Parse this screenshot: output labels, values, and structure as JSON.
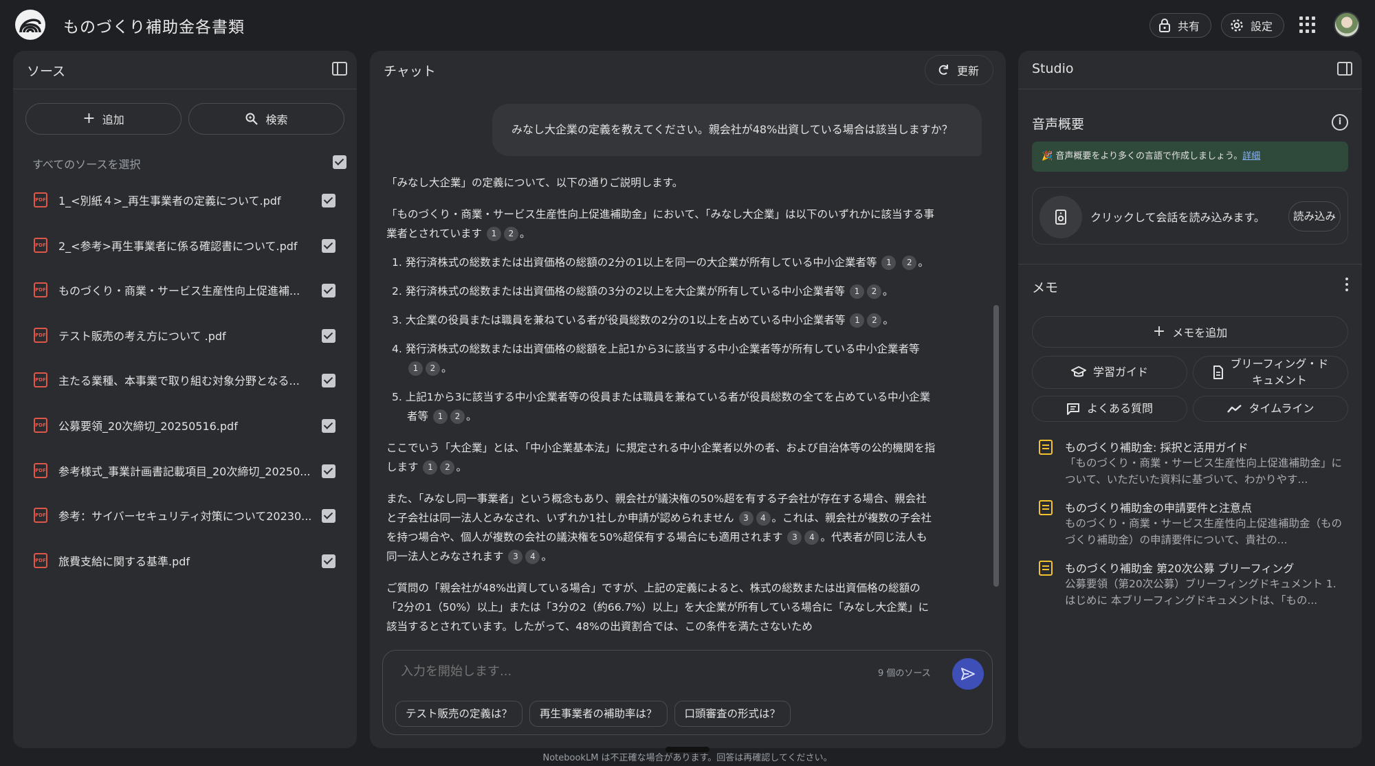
{
  "app": {
    "title": "ものづくり補助金各書類"
  },
  "header": {
    "share_label": "共有",
    "settings_label": "設定"
  },
  "sources": {
    "title": "ソース",
    "add_label": "追加",
    "search_label": "検索",
    "select_all_label": "すべてのソースを選択",
    "items": [
      {
        "label": "1_<別紙４>_再生事業者の定義について.pdf",
        "checked": true
      },
      {
        "label": "2_<参考>再生事業者に係る確認書について.pdf",
        "checked": true
      },
      {
        "label": "ものづくり・商業・サービス生産性向上促進補...",
        "checked": true
      },
      {
        "label": "テスト販売の考え方について .pdf",
        "checked": true
      },
      {
        "label": "主たる業種、本事業で取り組む対象分野となる...",
        "checked": true
      },
      {
        "label": "公募要領_20次締切_20250516.pdf",
        "checked": true
      },
      {
        "label": "参考様式_事業計画書記載項目_20次締切_20250...",
        "checked": true
      },
      {
        "label": "参考：サイバーセキュリティ対策について20230...",
        "checked": true
      },
      {
        "label": "旅費支給に関する基準.pdf",
        "checked": true
      }
    ]
  },
  "chat": {
    "title": "チャット",
    "refresh_label": "更新",
    "user_message": "みなし大企業の定義を教えてください。親会社が48%出資している場合は該当しますか？",
    "answer": {
      "p1": "「みなし大企業」の定義について、以下の通りご説明します。",
      "p2": "「ものづくり・商業・サービス生産性向上促進補助金」において、「みなし大企業」は以下のいずれかに該当する事業者とされています",
      "li1": "1. 発行済株式の総数または出資価格の総額の2分の1以上を同一の大企業が所有している中小企業者等",
      "li2": "2. 発行済株式の総数または出資価格の総額の3分の2以上を大企業が所有している中小企業者等",
      "li3": "3. 大企業の役員または職員を兼ねている者が役員総数の2分の1以上を占めている中小企業者等",
      "li4": "4. 発行済株式の総数または出資価格の総額を上記1から3に該当する中小企業者等が所有している中小企業者等",
      "li5": "5. 上記1から3に該当する中小企業者等の役員または職員を兼ねている者が役員総数の全てを占めている中小企業者等",
      "p3": "ここでいう「大企業」とは、「中小企業基本法」に規定される中小企業者以外の者、および自治体等の公的機関を指します",
      "p4a": "また、「みなし同一事業者」という概念もあり、親会社が議決権の50%超を有する子会社が存在する場合、親会社と子会社は同一法人とみなされ、いずれか1社しか申請が認められません",
      "p4b": "。これは、親会社が複数の子会社を持つ場合や、個人が複数の会社の議決権を50%超保有する場合にも適用されます",
      "p4c": "代表者が同じ法人も同一法人とみなされます",
      "p5": "ご質問の「親会社が48%出資している場合」ですが、上記の定義によると、株式の総数または出資価格の総額の「2分の1（50%）以上」または「3分の2（約66.7%）以上」を大企業が所有している場合に「みなし大企業」に該当するとされています。したがって、48%の出資割合では、この条件を満たさないため"
    },
    "input_placeholder": "入力を開始します...",
    "source_count": "9 個のソース",
    "suggestions": [
      "テスト販売の定義は？",
      "再生事業者の補助率は？",
      "口頭審査の形式は？"
    ],
    "period": "。"
  },
  "studio": {
    "title": "Studio",
    "audio_title": "音声概要",
    "banner_text": "🎉 音声概要をより多くの言語で作成しましょう。",
    "banner_link": "詳細",
    "audio_card_text": "クリックして会話を読み込みます。",
    "load_label": "読み込み",
    "memo_title": "メモ",
    "add_memo_label": "メモを追加",
    "tools": {
      "study_guide": "学習ガイド",
      "briefing_line1": "ブリーフィング・ド",
      "briefing_line2": "キュメント",
      "faq": "よくある質問",
      "timeline": "タイムライン"
    },
    "notes": [
      {
        "title": "ものづくり補助金: 採択と活用ガイド",
        "desc": "「ものづくり・商業・サービス生産性向上促進補助金」について、いただいた資料に基づいて、わかりやす..."
      },
      {
        "title": "ものづくり補助金の申請要件と注意点",
        "desc": "ものづくり・商業・サービス生産性向上促進補助金（ものづくり補助金）の申請要件について、貴社の..."
      },
      {
        "title": "ものづくり補助金 第20次公募 ブリーフィング",
        "desc": "公募要領（第20次公募）ブリーフィングドキュメント 1. はじめに 本ブリーフィングドキュメントは、「もの..."
      }
    ]
  },
  "footer": {
    "disclaimer": "NotebookLM は不正確な場合があります。回答は再確認してください。"
  },
  "colors": {
    "accent": "#3e4fb7",
    "pdf": "#e0574a",
    "note": "#f2c230",
    "panel": "#2b2c30",
    "background": "#1f2023"
  }
}
